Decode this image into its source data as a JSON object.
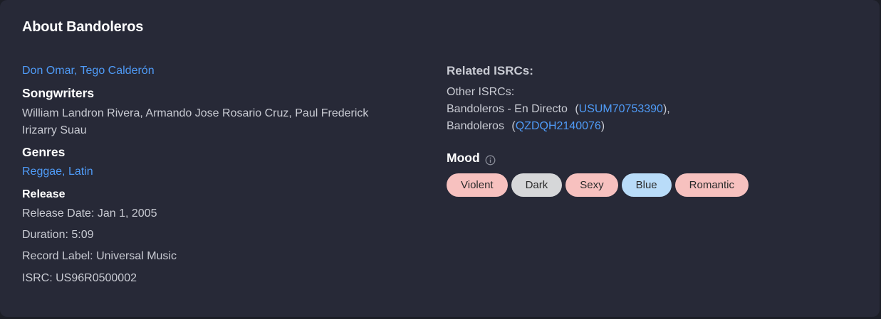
{
  "title": "About Bandoleros",
  "artists": "Don Omar, Tego Calderón",
  "songwriters": {
    "heading": "Songwriters",
    "line1": "William Landron Rivera, Armando Jose Rosario Cruz, Paul Frederick",
    "line2": "Irizarry Suau"
  },
  "genres": {
    "heading": "Genres",
    "value": "Reggae, Latin"
  },
  "release": {
    "heading": "Release",
    "date": "Release Date: Jan 1, 2005",
    "duration": "Duration: 5:09",
    "label": "Record Label: Universal Music",
    "isrc": "ISRC: US96R0500002"
  },
  "related": {
    "heading": "Related ISRCs:",
    "other_label": "Other ISRCs:",
    "items": [
      {
        "title": "Bandoleros - En Directo",
        "open": "(",
        "code": "USUM70753390",
        "close": "),"
      },
      {
        "title": "Bandoleros",
        "open": "(",
        "code": "QZDQH2140076",
        "close": ")"
      }
    ]
  },
  "mood": {
    "heading": "Mood",
    "info_icon": "info-icon",
    "chips": [
      {
        "label": "Violent",
        "color": "#f7c1bf"
      },
      {
        "label": "Dark",
        "color": "#d6d7d9"
      },
      {
        "label": "Sexy",
        "color": "#f7c1bf"
      },
      {
        "label": "Blue",
        "color": "#b9dcf9"
      },
      {
        "label": "Romantic",
        "color": "#f7c1bf"
      }
    ]
  }
}
